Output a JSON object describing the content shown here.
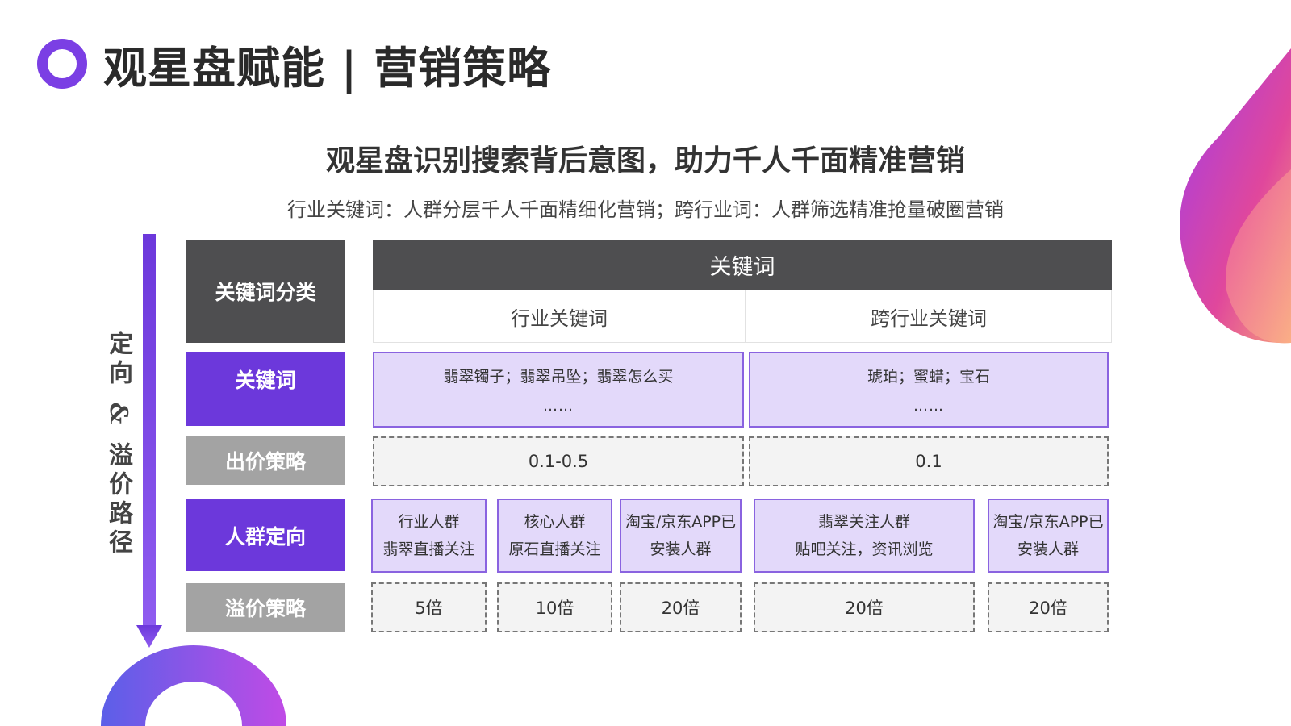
{
  "page": {
    "title": "观星盘赋能 | 营销策略",
    "subtitle": "观星盘识别搜索背后意图，助力千人千面精准营销",
    "description": "行业关键词：人群分层千人千面精细化营销；跨行业词：人群筛选精准抢量破圈营销"
  },
  "side_label": "定向 & 溢价路径",
  "row_labels": {
    "category": "关键词分类",
    "keywords": "关键词",
    "bid": "出价策略",
    "audience": "人群定向",
    "premium": "溢价策略"
  },
  "table": {
    "header": "关键词",
    "columns": [
      "行业关键词",
      "跨行业关键词"
    ],
    "keywords": [
      {
        "text": "翡翠镯子；翡翠吊坠；翡翠怎么买",
        "more": "……"
      },
      {
        "text": "琥珀；蜜蜡；宝石",
        "more": "……"
      }
    ],
    "bids": [
      "0.1-0.5",
      "0.1"
    ],
    "audiences": [
      {
        "line1": "行业人群",
        "line2": "翡翠直播关注"
      },
      {
        "line1": "核心人群",
        "line2": "原石直播关注"
      },
      {
        "line1": "淘宝/京东APP已",
        "line2": "安装人群"
      },
      {
        "line1": "翡翠关注人群",
        "line2": "贴吧关注，资讯浏览"
      },
      {
        "line1": "淘宝/京东APP已",
        "line2": "安装人群"
      }
    ],
    "premiums": [
      "5倍",
      "10倍",
      "20倍",
      "20倍",
      "20倍"
    ]
  },
  "colors": {
    "accent_purple": "#6c38db",
    "dark_gray": "#4e4e50",
    "light_gray": "#a3a3a3",
    "light_purple": "#e3d9fa"
  }
}
